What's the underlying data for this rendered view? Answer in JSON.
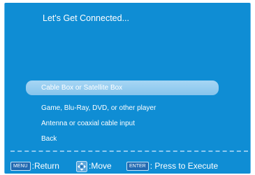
{
  "title": "Let's Get Connected...",
  "menu": {
    "items": [
      {
        "label": "Cable Box or Satellite Box",
        "selected": true
      },
      {
        "label": "Game, Blu-Ray, DVD, or other player",
        "selected": false
      },
      {
        "label": "Antenna or coaxial cable input",
        "selected": false
      },
      {
        "label": "Back",
        "selected": false
      }
    ]
  },
  "footer": {
    "menu_key": "MENU",
    "return_label": ":Return",
    "move_icon": "dpad-arrows-icon",
    "move_label": ":Move",
    "enter_key": "ENTER",
    "execute_label": ": Press to Execute"
  },
  "colors": {
    "background": "#0f8dd4",
    "highlight": "#a7d6f4",
    "text": "#ffffff",
    "key_badge": "#2169b1"
  }
}
